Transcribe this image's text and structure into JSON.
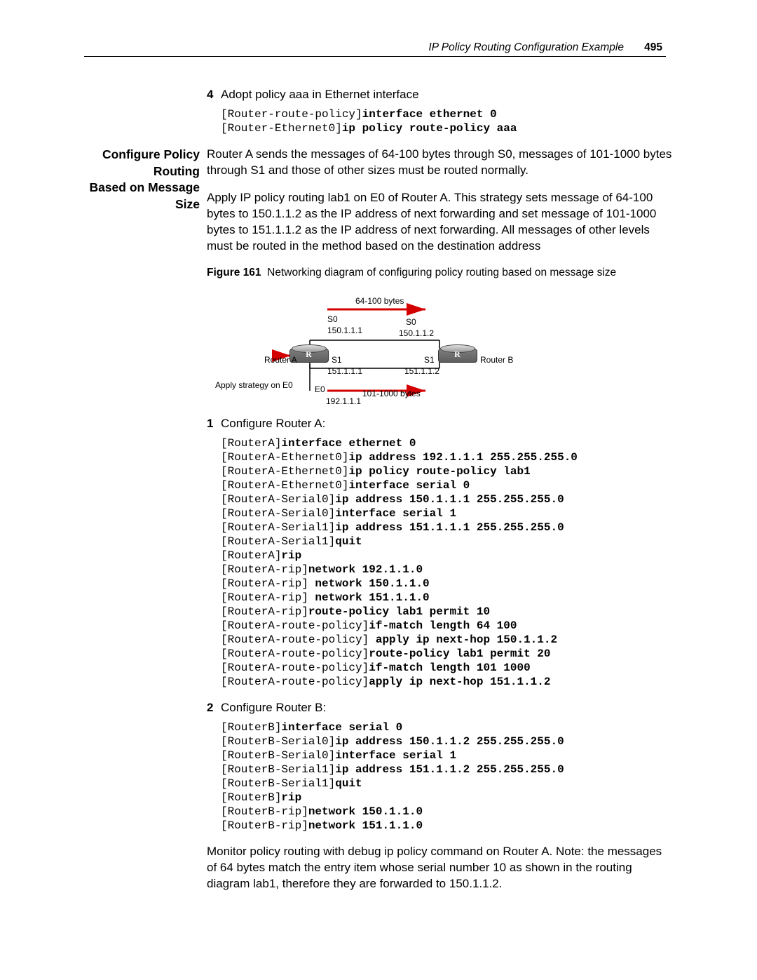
{
  "header": {
    "title": "IP Policy Routing Configuration Example",
    "page": "495"
  },
  "section1": {
    "step4_num": "4",
    "step4_text": "Adopt policy aaa in Ethernet interface",
    "codeA_l1_prompt": "[Router-route-policy]",
    "codeA_l1_cmd": "interface ethernet 0",
    "codeA_l2_prompt": "[Router-Ethernet0]",
    "codeA_l2_cmd": "ip policy route-policy aaa"
  },
  "section2": {
    "sidehead_l1": "Configure Policy Routing",
    "sidehead_l2": "Based on Message Size",
    "para1": "Router A sends the messages of 64-100 bytes through S0, messages of 101-1000 bytes through S1 and those of other sizes must be routed normally.",
    "para2": "Apply IP policy routing lab1 on E0 of Router A. This strategy sets message of 64-100 bytes to 150.1.1.2 as the IP address of next forwarding and set message of 101-1000 bytes to 151.1.1.2 as the IP address of next forwarding. All messages of other levels must be routed in the method based on the destination address",
    "figure_label": "Figure 161",
    "figure_caption": "Networking diagram of configuring policy routing based on message size"
  },
  "diagram": {
    "top_bytes": "64-100 bytes",
    "bot_bytes": "101-1000 bytes",
    "routerA_name": "Router A",
    "routerB_name": "Router B",
    "s0_left": "S0",
    "s0_left_ip": "150.1.1.1",
    "s0_right": "S0",
    "s0_right_ip": "150.1.1.2",
    "s1_left": "S1",
    "s1_left_ip": "151.1.1.1",
    "s1_right": "S1",
    "s1_right_ip": "151.1.1.2",
    "e0": "E0",
    "e0_ip": "192.1.1.1",
    "apply_note": "Apply strategy on E0"
  },
  "config": {
    "step1_num": "1",
    "step1_text": "Configure Router A:",
    "codeA": [
      {
        "p": "[RouterA]",
        "c": "interface ethernet 0"
      },
      {
        "p": "[RouterA-Ethernet0]",
        "c": "ip address 192.1.1.1 255.255.255.0"
      },
      {
        "p": "[RouterA-Ethernet0]",
        "c": "ip policy route-policy lab1"
      },
      {
        "p": "[RouterA-Ethernet0]",
        "c": "interface serial 0"
      },
      {
        "p": "[RouterA-Serial0]",
        "c": "ip address 150.1.1.1 255.255.255.0"
      },
      {
        "p": "[RouterA-Serial0]",
        "c": "interface serial 1"
      },
      {
        "p": "[RouterA-Serial1]",
        "c": "ip address 151.1.1.1 255.255.255.0"
      },
      {
        "p": "[RouterA-Serial1]",
        "c": "quit"
      },
      {
        "p": "[RouterA]",
        "c": "rip"
      },
      {
        "p": "[RouterA-rip]",
        "c": "network 192.1.1.0"
      },
      {
        "p": "[RouterA-rip] ",
        "c": "network 150.1.1.0"
      },
      {
        "p": "[RouterA-rip] ",
        "c": "network 151.1.1.0"
      },
      {
        "p": "[RouterA-rip]",
        "c": "route-policy lab1 permit 10"
      },
      {
        "p": "[RouterA-route-policy]",
        "c": "if-match length 64 100"
      },
      {
        "p": "[RouterA-route-policy] ",
        "c": "apply ip next-hop 150.1.1.2"
      },
      {
        "p": "[RouterA-route-policy]",
        "c": "route-policy lab1 permit 20"
      },
      {
        "p": "[RouterA-route-policy]",
        "c": "if-match length 101 1000"
      },
      {
        "p": "[RouterA-route-policy]",
        "c": "apply ip next-hop 151.1.1.2"
      }
    ],
    "step2_num": "2",
    "step2_text": "Configure Router B:",
    "codeB": [
      {
        "p": "[RouterB]",
        "c": "interface serial 0"
      },
      {
        "p": "[RouterB-Serial0]",
        "c": "ip address 150.1.1.2 255.255.255.0"
      },
      {
        "p": "[RouterB-Serial0]",
        "c": "interface serial 1"
      },
      {
        "p": "[RouterB-Serial1]",
        "c": "ip address 151.1.1.2 255.255.255.0"
      },
      {
        "p": "[RouterB-Serial1]",
        "c": "quit"
      },
      {
        "p": "[RouterB]",
        "c": "rip"
      },
      {
        "p": "[RouterB-rip]",
        "c": "network 150.1.1.0"
      },
      {
        "p": "[RouterB-rip]",
        "c": "network 151.1.1.0"
      }
    ]
  },
  "closing": {
    "para": "Monitor policy routing with debug ip policy command on Router A. Note: the messages of 64 bytes match the entry item whose serial number 10 as shown in the routing diagram lab1, therefore they are forwarded to 150.1.1.2."
  }
}
